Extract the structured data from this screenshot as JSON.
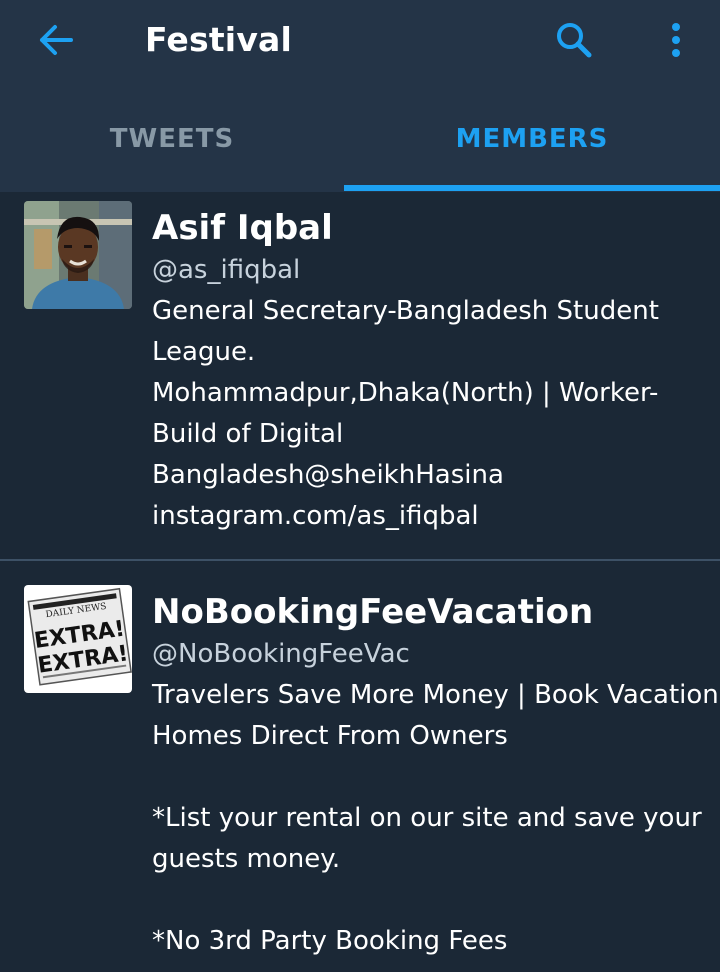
{
  "header": {
    "title": "Festival",
    "back_icon": "arrow-left-icon",
    "search_icon": "search-icon",
    "more_icon": "more-vertical-icon",
    "accent_color": "#1da1f2"
  },
  "tabs": [
    {
      "label": "TWEETS",
      "active": false
    },
    {
      "label": "MEMBERS",
      "active": true
    }
  ],
  "members": [
    {
      "name": "Asif Iqbal",
      "handle": "@as_ifiqbal",
      "bio_lines": [
        "General Secretary-Bangladesh Student",
        "League.",
        "Mohammadpur,Dhaka(North) |  Worker-",
        "Build of Digital",
        "Bangladesh@sheikhHasina",
        "instagram.com/as_ifiqbal"
      ]
    },
    {
      "name": "NoBookingFeeVacation",
      "handle": "@NoBookingFeeVac",
      "avatar_text_top": "DAILY NEWS",
      "avatar_text_1": "EXTRA!",
      "avatar_text_2": "EXTRA!",
      "bio_lines": [
        "Travelers Save More Money | Book Vacation",
        "Homes Direct From Owners",
        "",
        "*List your rental on our site and save your",
        "guests money.",
        "",
        "*No 3rd Party Booking Fees"
      ]
    }
  ]
}
